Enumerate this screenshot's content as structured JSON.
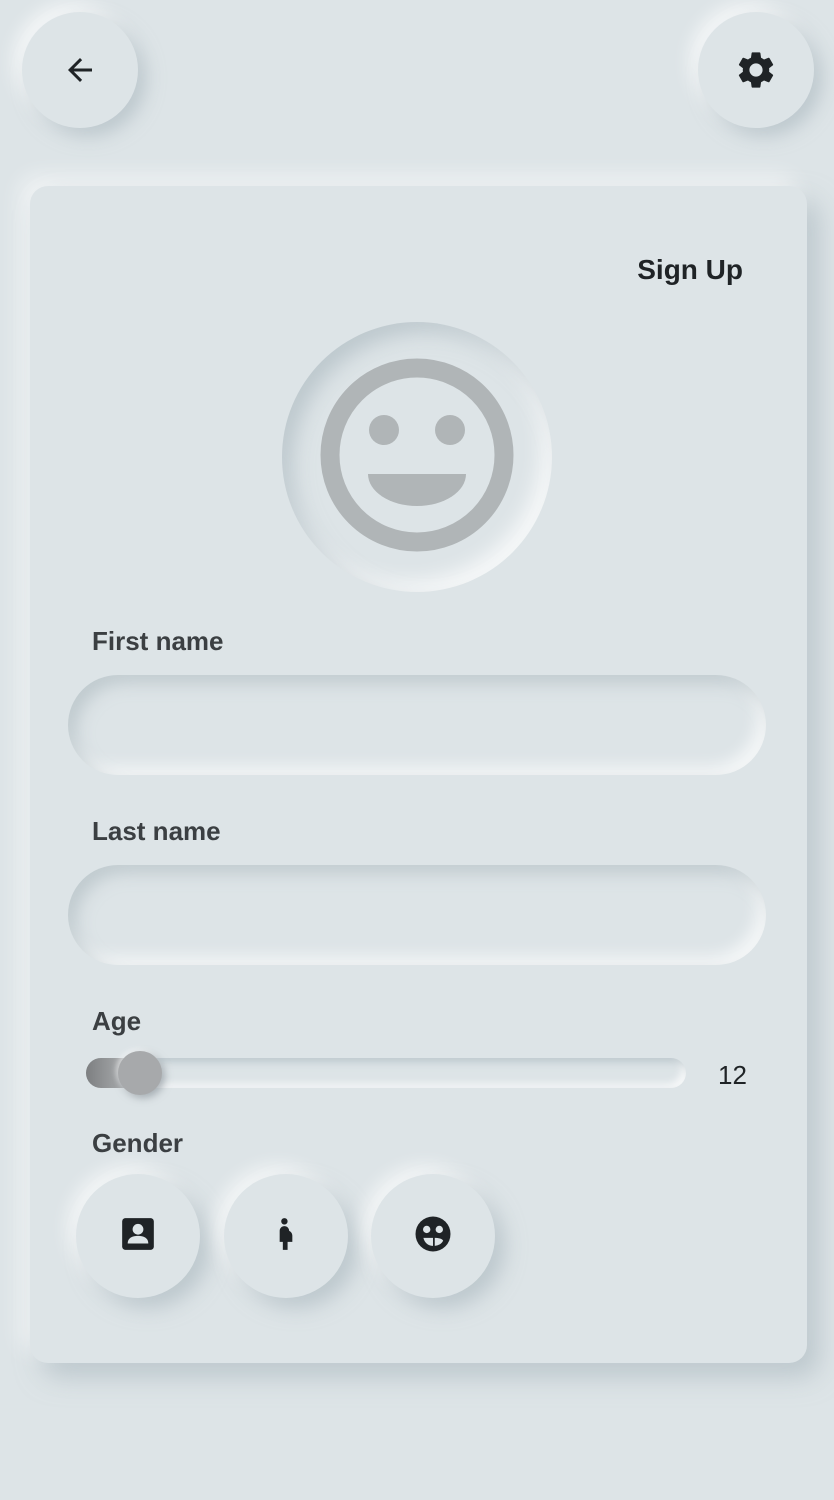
{
  "header": {
    "back_icon": "arrow-left-icon",
    "settings_icon": "gear-icon"
  },
  "form": {
    "title": "Sign Up",
    "avatar_icon": "smiley-face-icon",
    "first_name": {
      "label": "First name",
      "value": "",
      "placeholder": ""
    },
    "last_name": {
      "label": "Last name",
      "value": "",
      "placeholder": ""
    },
    "age": {
      "label": "Age",
      "value": 12,
      "display": "12",
      "fraction": 0.09
    },
    "gender": {
      "label": "Gender",
      "options": [
        {
          "icon": "contact-card-icon"
        },
        {
          "icon": "pregnant-person-icon"
        },
        {
          "icon": "face-palette-icon"
        }
      ]
    }
  },
  "colors": {
    "background": "#dde4e7",
    "icon_dark": "#1f2326",
    "avatar_gray": "#b0b5b7",
    "slider_thumb": "#a7a9ab"
  }
}
